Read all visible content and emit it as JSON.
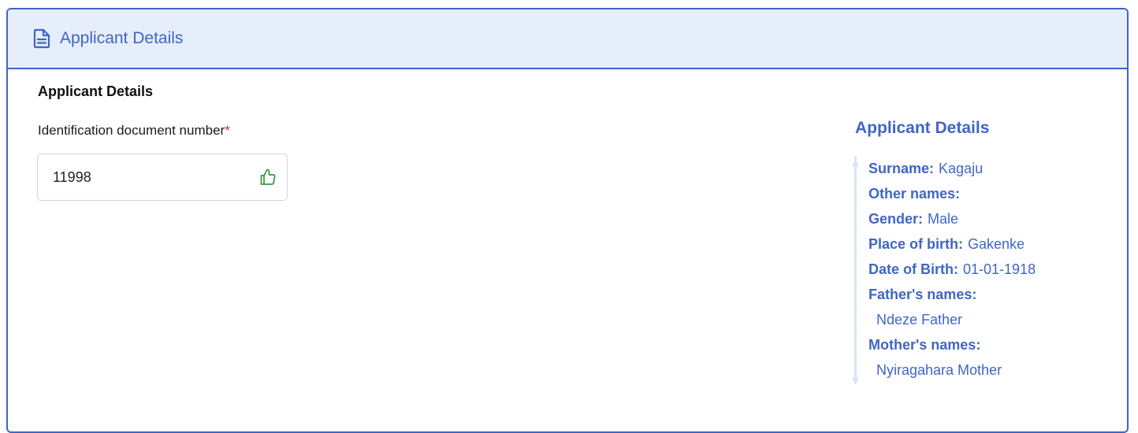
{
  "header": {
    "title": "Applicant Details",
    "icon": "document-icon"
  },
  "form": {
    "section_title": "Applicant Details",
    "id_label": "Identification document number",
    "required_mark": "*",
    "id_value": "11998",
    "validation_icon": "thumbs-up-icon"
  },
  "summary": {
    "title": "Applicant Details",
    "surname_label": "Surname:",
    "surname": "Kagaju",
    "other_names_label": "Other names:",
    "other_names": "",
    "gender_label": "Gender:",
    "gender": "Male",
    "place_of_birth_label": "Place of birth:",
    "place_of_birth": "Gakenke",
    "dob_label": "Date of Birth:",
    "dob": "01-01-1918",
    "father_label": "Father's names:",
    "father": "Ndeze Father",
    "mother_label": "Mother's names:",
    "mother": "Nyiragahara Mother"
  },
  "colors": {
    "accent": "#3f66c6",
    "header_bg": "#e6eefb",
    "success": "#3a9a4b",
    "required": "#d9262c"
  }
}
